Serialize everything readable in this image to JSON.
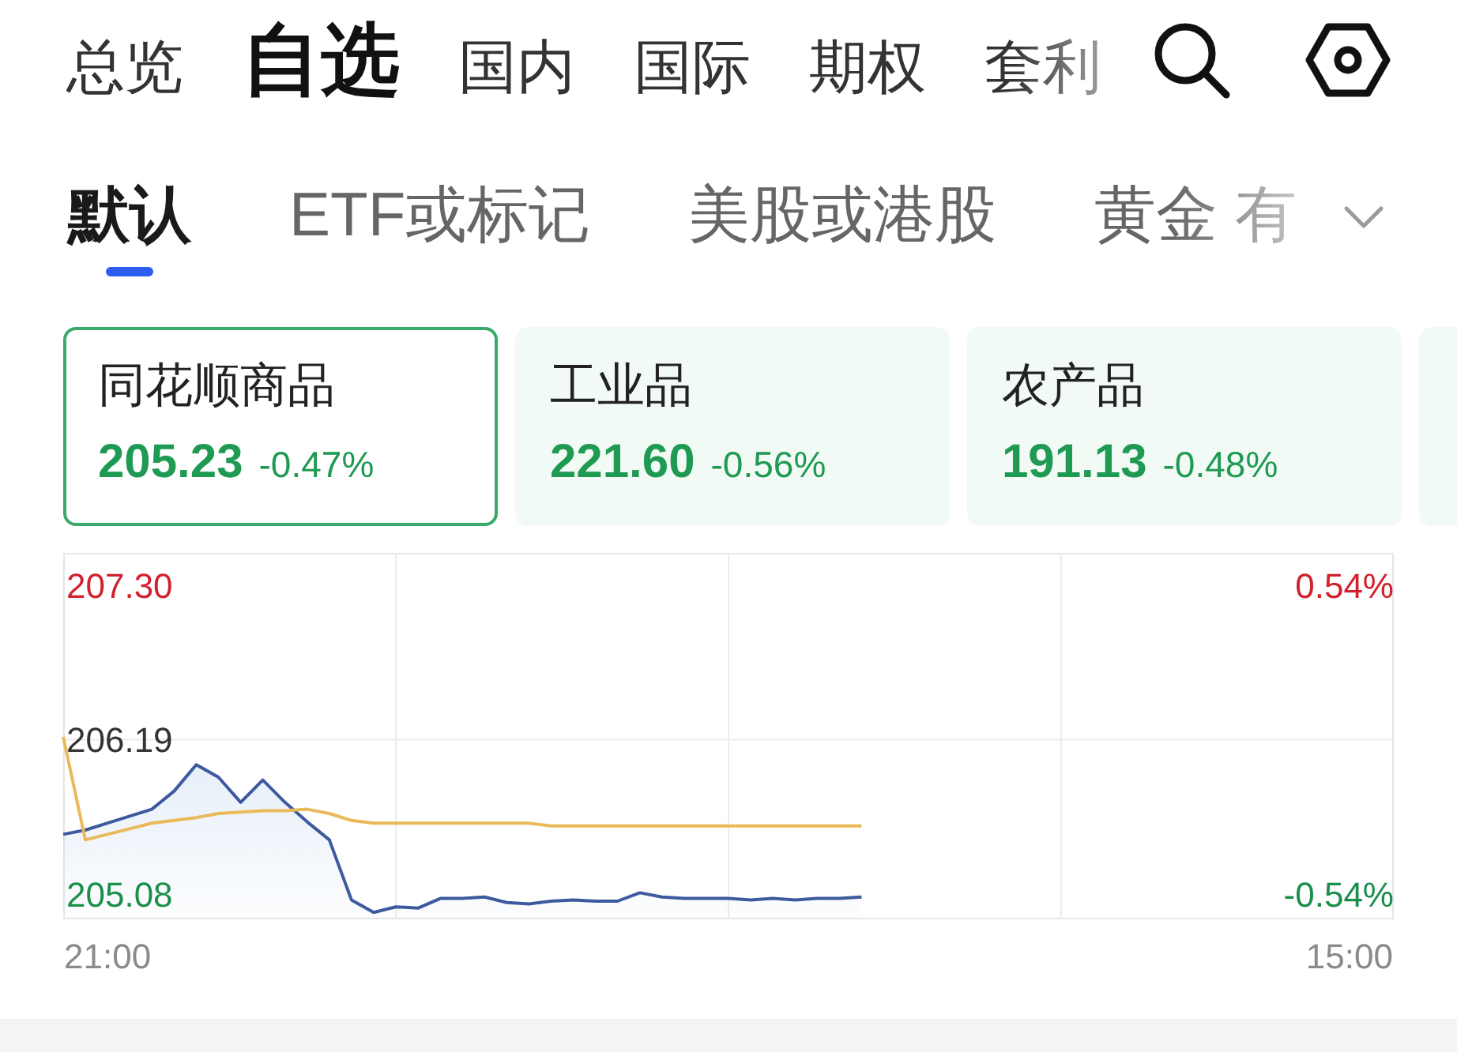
{
  "top_tabs": [
    {
      "label": "总览",
      "selected": false
    },
    {
      "label": "自选",
      "selected": true
    },
    {
      "label": "国内",
      "selected": false
    },
    {
      "label": "国际",
      "selected": false
    },
    {
      "label": "期权",
      "selected": false
    },
    {
      "label": "套利",
      "selected": false
    }
  ],
  "sub_tabs": [
    {
      "label": "默认",
      "selected": true
    },
    {
      "label": "ETF或标记",
      "selected": false
    },
    {
      "label": "美股或港股",
      "selected": false
    },
    {
      "label": "黄金 有",
      "selected": false
    }
  ],
  "index_cards": [
    {
      "name": "同花顺商品",
      "price": "205.23",
      "change": "-0.47%",
      "color": "#1f9a52",
      "selected": true
    },
    {
      "name": "工业品",
      "price": "221.60",
      "change": "-0.56%",
      "color": "#1f9a52",
      "selected": false
    },
    {
      "name": "农产品",
      "price": "191.13",
      "change": "-0.48%",
      "color": "#1f9a52",
      "selected": false
    },
    {
      "selected": false
    }
  ],
  "chart": {
    "chart_data": {
      "type": "line",
      "categories": [
        null,
        null,
        "21:00",
        null,
        null,
        null,
        null,
        null,
        null,
        null,
        null,
        null,
        null,
        null,
        null,
        null,
        null,
        null,
        null,
        null,
        null,
        null,
        null,
        null,
        null,
        null,
        null,
        null,
        null,
        null,
        null,
        null,
        null,
        null,
        null,
        null,
        null,
        null,
        null,
        null,
        null,
        null,
        null,
        null,
        null,
        null,
        null,
        null,
        null,
        null,
        null,
        null,
        null,
        null,
        null,
        null,
        null,
        null,
        "15:00",
        null,
        null
      ],
      "ylim": [
        204.9,
        207.53
      ],
      "yticks": [
        {
          "value": 207.3,
          "label": "207.30"
        },
        {
          "value": 206.19,
          "label": "206.19"
        },
        {
          "value": 205.08,
          "label": "205.08"
        }
      ],
      "annotations": [
        "0.54%",
        "-0.54%"
      ],
      "series": [
        {
          "color": "#3d5a9e",
          "values": [
            205.51,
            205.54,
            205.59,
            205.64,
            205.69,
            205.82,
            206.01,
            205.92,
            205.74,
            205.9,
            205.74,
            205.6,
            205.47,
            205.04,
            204.95,
            204.99,
            204.98,
            205.05,
            205.05,
            205.06,
            205.02,
            205.01,
            205.03,
            205.04,
            205.03,
            205.03,
            205.09,
            205.06,
            205.05,
            205.05,
            205.05,
            205.04,
            205.05,
            205.04,
            205.05,
            205.05,
            205.06,
            null,
            null,
            null,
            null,
            null,
            null,
            null,
            null,
            null,
            null,
            null,
            null,
            null,
            null,
            null,
            null,
            null,
            null,
            null,
            null,
            null,
            null,
            null,
            null
          ]
        },
        {
          "color": "#e9b95a",
          "values": [
            206.21,
            205.47,
            205.51,
            205.55,
            205.59,
            205.61,
            205.63,
            205.66,
            205.67,
            205.68,
            205.68,
            205.69,
            205.66,
            205.61,
            205.59,
            205.59,
            205.59,
            205.59,
            205.59,
            205.59,
            205.59,
            205.59,
            205.57,
            205.57,
            205.57,
            205.57,
            205.57,
            205.57,
            205.57,
            205.57,
            205.57,
            205.57,
            205.57,
            205.57,
            205.57,
            205.57,
            205.57,
            null,
            null,
            null,
            null,
            null,
            null,
            null,
            null,
            null,
            null,
            null,
            null,
            null,
            null,
            null,
            null,
            null,
            null,
            null,
            null,
            null,
            null,
            null,
            null
          ]
        }
      ]
    }
  }
}
